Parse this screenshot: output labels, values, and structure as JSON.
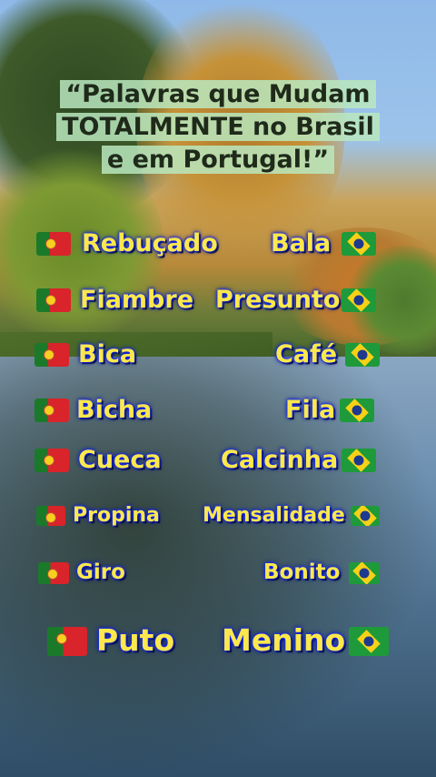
{
  "title_lines": [
    "“Palavras que Mudam",
    "TOTALMENTE no Brasil",
    "e em Portugal!”"
  ],
  "pairs": [
    {
      "pt": "Rebuçado",
      "br": "Bala"
    },
    {
      "pt": "Fiambre",
      "br": "Presunto"
    },
    {
      "pt": "Bica",
      "br": "Café"
    },
    {
      "pt": "Bicha",
      "br": "Fila"
    },
    {
      "pt": "Cueca",
      "br": "Calcinha"
    },
    {
      "pt": "Propina",
      "br": "Mensalidade"
    },
    {
      "pt": "Giro",
      "br": "Bonito"
    },
    {
      "pt": "Puto",
      "br": "Menino"
    }
  ],
  "icons": {
    "left": "portugal-flag-icon",
    "right": "brazil-flag-icon"
  },
  "colors": {
    "word_fill": "#fbe84b",
    "word_outline": "#1a2bff",
    "title_bg": "#bae8be"
  }
}
